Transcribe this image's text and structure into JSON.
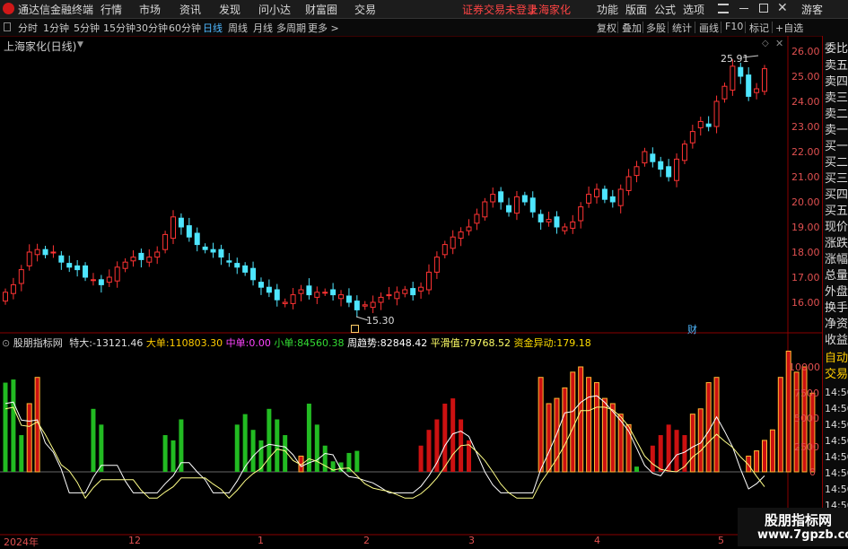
{
  "menubar": {
    "app_title": "通达信金融终端",
    "menus": [
      "行情",
      "市场",
      "资讯",
      "发现",
      "问小达",
      "财富圈",
      "交易"
    ],
    "notice": "证券交易未登录",
    "stock_name": "上海家化",
    "right": [
      "功能",
      "版面",
      "公式",
      "选项"
    ],
    "guest": "游客"
  },
  "toolbar": {
    "periods": [
      "分时",
      "1分钟",
      "5分钟",
      "15分钟",
      "30分钟",
      "60分钟",
      "日线",
      "周线",
      "月线",
      "多周期",
      "更多 >"
    ],
    "selected_period": "日线",
    "tools": [
      "复权",
      "叠加",
      "多股",
      "统计",
      "画线",
      "F10",
      "标记",
      "+自选"
    ]
  },
  "main_chart": {
    "title": "上海家化(日线)",
    "high_label": "25.91",
    "low_label": "15.30",
    "event_marker": "财",
    "y_ticks": [
      "26.00",
      "25.00",
      "24.00",
      "23.00",
      "22.00",
      "21.00",
      "20.00",
      "19.00",
      "18.00",
      "17.00",
      "16.00"
    ]
  },
  "indicator": {
    "name": "股朋指标网",
    "values": [
      {
        "label": "特大:",
        "value": "-13121.46",
        "color": "#e0e0e0"
      },
      {
        "label": "大单:",
        "value": "110803.30",
        "color": "#ffcc00"
      },
      {
        "label": "中单:",
        "value": "0.00",
        "color": "#ff44ff"
      },
      {
        "label": "小单:",
        "value": "84560.38",
        "color": "#33dd33"
      },
      {
        "label": "周趋势:",
        "value": "82848.42",
        "color": "#ffffff"
      },
      {
        "label": "平滑值:",
        "value": "79768.52",
        "color": "#ffff66"
      },
      {
        "label": "资金异动:",
        "value": "179.18",
        "color": "#ffdd00"
      }
    ],
    "y_ticks": [
      "10000",
      "7500",
      "5000",
      "2500",
      "0"
    ],
    "right_ticks": [
      "14:50",
      "14:50",
      "14:50",
      "14:50",
      "14:50",
      "14:50",
      "14:50",
      "14:50"
    ]
  },
  "x_axis": {
    "labels": [
      "2024年",
      "12",
      "1",
      "2",
      "3",
      "4",
      "5"
    ]
  },
  "right_panel": {
    "items": [
      "委比",
      "卖五",
      "卖四",
      "卖三",
      "卖二",
      "卖一",
      "买一",
      "买二",
      "买三",
      "买四",
      "买五",
      "现价",
      "涨跌",
      "涨幅",
      "总量",
      "外盘",
      "换手",
      "净资",
      "收益"
    ],
    "mode_items": [
      "自动",
      "交易"
    ]
  },
  "colors": {
    "up": "#ff3333",
    "down": "#4ee6ff",
    "green": "#22bb22",
    "red_bar": "#cc1111",
    "yellow_bar": "#ffb833",
    "line_white": "#ffffff",
    "line_yellow": "#ffff88"
  },
  "watermark": {
    "title": "股朋指标网",
    "url": "www.7gpzb.com"
  },
  "chart_data": [
    {
      "type": "candlestick",
      "title": "上海家化(日线)",
      "ylim": [
        15.0,
        26.5
      ],
      "high": 25.91,
      "low": 15.3,
      "close": [
        16.4,
        16.7,
        17.3,
        18.0,
        18.1,
        17.9,
        18.0,
        17.6,
        17.4,
        17.3,
        17.0,
        16.9,
        16.7,
        17.0,
        17.4,
        17.6,
        17.8,
        17.7,
        17.8,
        18.0,
        18.7,
        19.4,
        19.0,
        18.6,
        18.3,
        18.1,
        18.0,
        17.8,
        17.6,
        17.4,
        17.2,
        16.9,
        16.6,
        16.4,
        16.1,
        16.0,
        16.3,
        16.5,
        16.3,
        16.4,
        16.4,
        16.3,
        16.3,
        16.0,
        15.7,
        15.9,
        16.0,
        16.2,
        16.3,
        16.4,
        16.5,
        16.3,
        16.6,
        17.2,
        17.8,
        18.3,
        18.6,
        18.8,
        19.0,
        19.5,
        20.0,
        20.3,
        20.0,
        19.6,
        20.2,
        20.0,
        19.6,
        19.2,
        19.3,
        19.0,
        19.0,
        19.2,
        19.8,
        20.3,
        20.5,
        20.1,
        20.0,
        20.5,
        21.0,
        21.4,
        22.0,
        21.6,
        21.3,
        21.0,
        21.7,
        22.3,
        22.8,
        23.2,
        23.0,
        24.0,
        24.6,
        25.4,
        25.0,
        24.2,
        24.5,
        25.3
      ]
    },
    {
      "type": "bar",
      "name": "股朋指标网",
      "ylim": [
        -4500,
        11000
      ],
      "series": [
        {
          "name": "green",
          "values": [
            8500,
            8800,
            3500,
            0,
            0,
            0,
            0,
            0,
            0,
            0,
            0,
            6000,
            4500,
            0,
            0,
            0,
            0,
            0,
            0,
            0,
            3500,
            3000,
            5000,
            0,
            0,
            0,
            0,
            0,
            0,
            4500,
            5500,
            4000,
            3000,
            6000,
            5000,
            3500,
            0,
            0,
            6500,
            4500,
            2500,
            1000,
            900,
            1800,
            2000,
            0,
            0,
            0,
            0,
            0,
            0,
            0,
            0,
            0,
            0,
            0,
            0,
            0,
            0,
            0,
            0,
            0,
            0,
            0,
            0,
            0,
            0,
            0,
            0,
            0,
            0,
            0,
            0,
            0,
            0,
            0,
            1500,
            1500,
            800,
            500,
            0,
            0,
            0,
            0,
            0,
            0,
            0,
            0,
            0,
            0,
            0,
            0,
            0,
            0,
            0,
            0
          ]
        },
        {
          "name": "red",
          "values": [
            0,
            0,
            0,
            0,
            0,
            0,
            0,
            0,
            0,
            0,
            0,
            0,
            0,
            0,
            0,
            0,
            0,
            0,
            0,
            0,
            0,
            0,
            0,
            0,
            0,
            0,
            0,
            0,
            0,
            0,
            0,
            0,
            0,
            0,
            0,
            0,
            0,
            0,
            0,
            0,
            0,
            0,
            0,
            0,
            0,
            0,
            0,
            0,
            0,
            0,
            0,
            0,
            2500,
            4000,
            5000,
            6500,
            7000,
            5000,
            3000,
            0,
            0,
            0,
            0,
            0,
            0,
            0,
            0,
            0,
            0,
            0,
            0,
            0,
            0,
            0,
            0,
            0,
            0,
            0,
            0,
            0,
            0,
            2500,
            3500,
            4500,
            4000,
            3500,
            0,
            0,
            0,
            0,
            0,
            0,
            0,
            0,
            0,
            0
          ]
        },
        {
          "name": "yellow",
          "values": [
            0,
            0,
            0,
            6500,
            9000,
            0,
            0,
            0,
            0,
            0,
            0,
            0,
            0,
            0,
            0,
            0,
            0,
            0,
            0,
            0,
            0,
            0,
            0,
            0,
            0,
            0,
            0,
            0,
            0,
            0,
            0,
            0,
            0,
            0,
            0,
            0,
            0,
            1500,
            0,
            0,
            0,
            0,
            0,
            0,
            0,
            0,
            0,
            0,
            0,
            0,
            0,
            0,
            0,
            0,
            0,
            0,
            0,
            0,
            0,
            0,
            0,
            0,
            0,
            0,
            0,
            0,
            0,
            9000,
            6500,
            7000,
            8000,
            9500,
            10000,
            9000,
            8500,
            7000,
            6500,
            5500,
            4500,
            0,
            0,
            0,
            0,
            0,
            0,
            0,
            5500,
            6000,
            8500,
            9000,
            0,
            0,
            0,
            1500,
            2000,
            3000,
            4000,
            9000,
            11500,
            9500,
            10000,
            7500
          ]
        }
      ]
    }
  ]
}
